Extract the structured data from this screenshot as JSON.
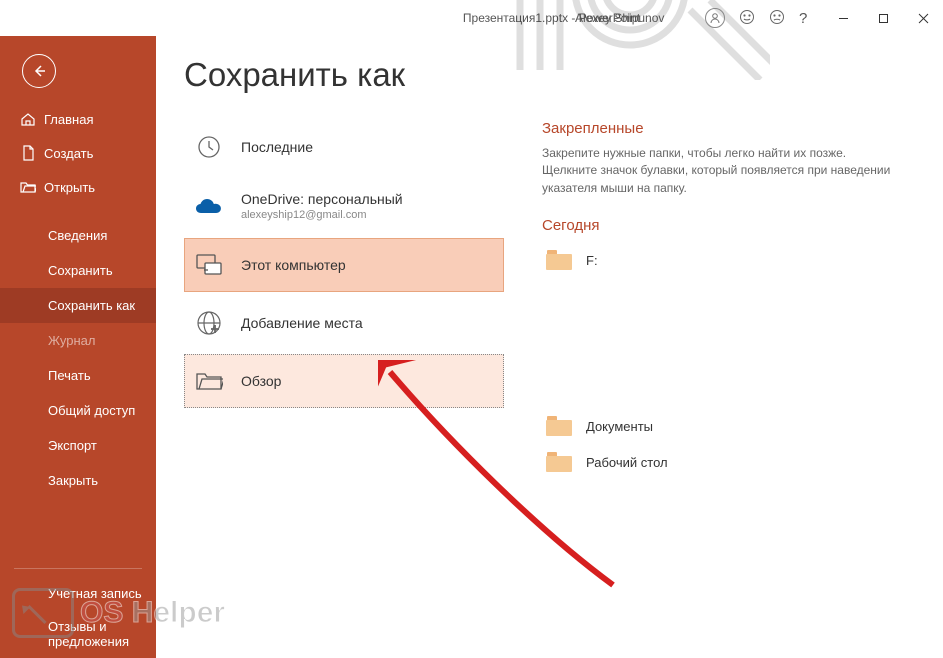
{
  "titlebar": {
    "title": "Презентация1.pptx - PowerPoint",
    "user": "Alexey Shipunov"
  },
  "page_title": "Сохранить как",
  "sidebar": {
    "top": [
      {
        "label": "Главная",
        "icon": "home"
      },
      {
        "label": "Создать",
        "icon": "new"
      },
      {
        "label": "Открыть",
        "icon": "open"
      }
    ],
    "mid": [
      {
        "label": "Сведения"
      },
      {
        "label": "Сохранить"
      },
      {
        "label": "Сохранить как",
        "active": true
      },
      {
        "label": "Журнал",
        "dim": true
      },
      {
        "label": "Печать"
      },
      {
        "label": "Общий доступ"
      },
      {
        "label": "Экспорт"
      },
      {
        "label": "Закрыть"
      }
    ],
    "bottom": [
      {
        "label": "Учетная запись"
      },
      {
        "label": "Отзывы и предложения"
      }
    ]
  },
  "locations": [
    {
      "label": "Последние",
      "icon": "recent"
    },
    {
      "label": "OneDrive: персональный",
      "sub": "alexeyship12@gmail.com",
      "icon": "onedrive"
    },
    {
      "label": "Этот компьютер",
      "icon": "thispc",
      "selected": true
    },
    {
      "label": "Добавление места",
      "icon": "addplace"
    },
    {
      "label": "Обзор",
      "icon": "browse",
      "highlight": true
    }
  ],
  "right": {
    "pinned_title": "Закрепленные",
    "pinned_desc": "Закрепите нужные папки, чтобы легко найти их позже. Щелкните значок булавки, который появляется при наведении указателя мыши на папку.",
    "today_title": "Сегодня",
    "folders_today": [
      {
        "label": "F:"
      }
    ],
    "folders_other": [
      {
        "label": "Документы"
      },
      {
        "label": "Рабочий стол"
      }
    ]
  },
  "watermark": {
    "text1": "OS",
    "text2": " Helper"
  }
}
